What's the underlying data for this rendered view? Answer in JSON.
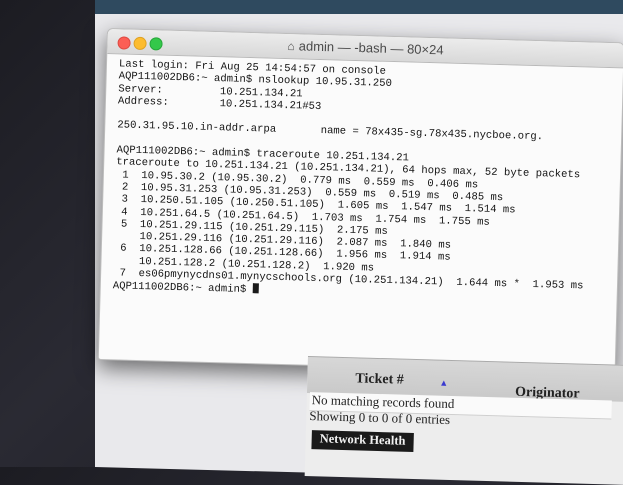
{
  "terminal": {
    "title": "admin — -bash — 80×24",
    "lines": [
      "Last login: Fri Aug 25 14:54:57 on console",
      "AQP111002DB6:~ admin$ nslookup 10.95.31.250",
      "Server:         10.251.134.21",
      "Address:        10.251.134.21#53",
      "",
      "250.31.95.10.in-addr.arpa       name = 78x435-sg.78x435.nycboe.org.",
      "",
      "AQP111002DB6:~ admin$ traceroute 10.251.134.21",
      "traceroute to 10.251.134.21 (10.251.134.21), 64 hops max, 52 byte packets",
      " 1  10.95.30.2 (10.95.30.2)  0.779 ms  0.559 ms  0.406 ms",
      " 2  10.95.31.253 (10.95.31.253)  0.559 ms  0.519 ms  0.485 ms",
      " 3  10.250.51.105 (10.250.51.105)  1.605 ms  1.547 ms  1.514 ms",
      " 4  10.251.64.5 (10.251.64.5)  1.703 ms  1.754 ms  1.755 ms",
      " 5  10.251.29.115 (10.251.29.115)  2.175 ms",
      "    10.251.29.116 (10.251.29.116)  2.087 ms  1.840 ms",
      " 6  10.251.128.66 (10.251.128.66)  1.956 ms  1.914 ms",
      "    10.251.128.2 (10.251.128.2)  1.920 ms",
      " 7  es06pmynycdns01.mynycschools.org (10.251.134.21)  1.644 ms *  1.953 ms"
    ],
    "prompt": "AQP111002DB6:~ admin$ "
  },
  "panel": {
    "col_ticket": "Ticket #",
    "col_originator": "Originator",
    "empty_text": "No matching records found",
    "showing_text": "Showing 0 to 0 of 0 entries",
    "section_title": "Network Health"
  },
  "colors": {
    "close": "#fc5e55",
    "minimize": "#fdbc2e",
    "zoom": "#34c84a",
    "sort_arrow": "#3a3ad0"
  },
  "icons": [
    "home-icon",
    "sort-ascending-icon",
    "close-icon",
    "minimize-icon",
    "zoom-icon"
  ]
}
